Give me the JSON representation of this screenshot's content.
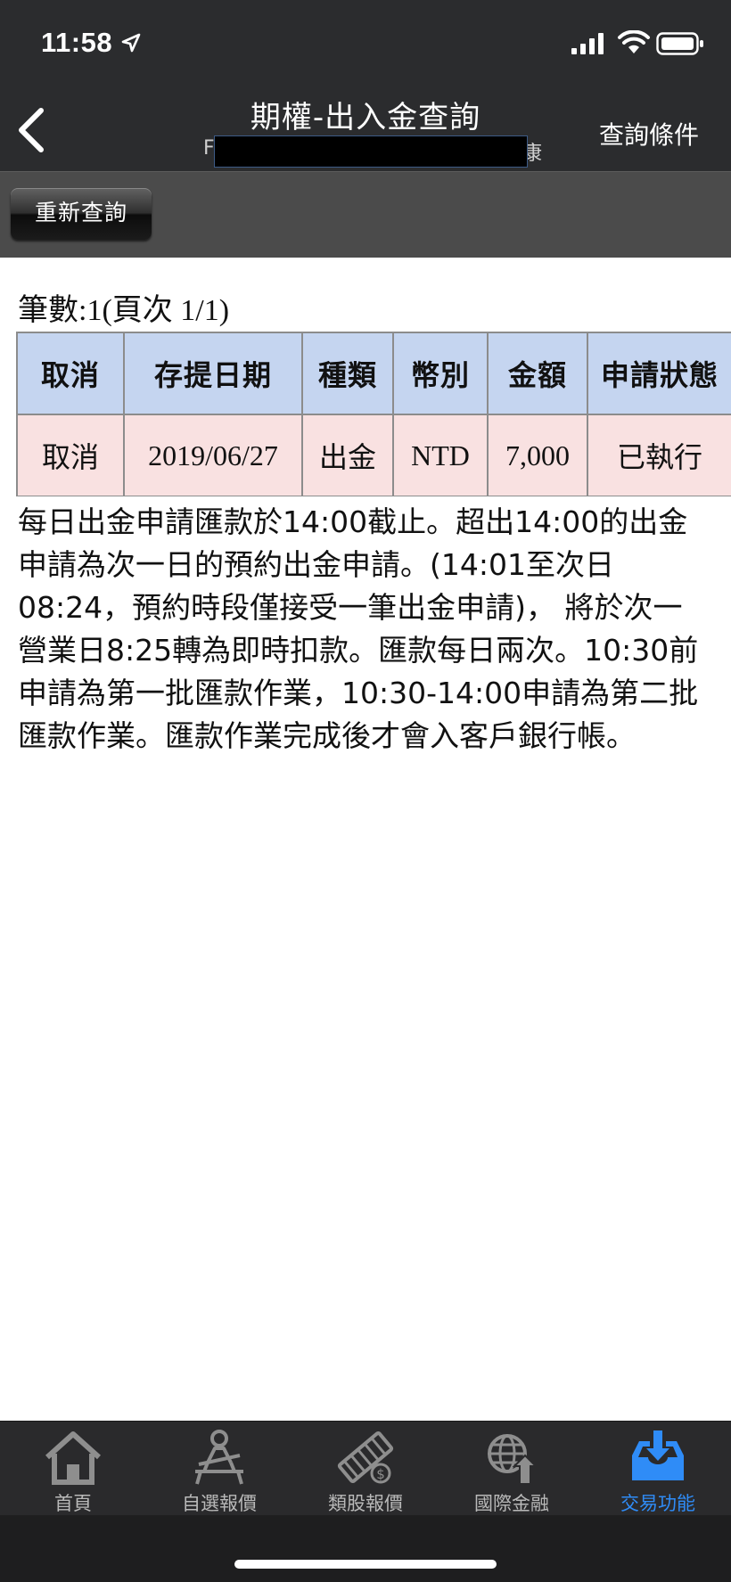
{
  "status_bar": {
    "time": "11:58"
  },
  "nav": {
    "title": "期權-出入金查詢",
    "account_prefix": "F",
    "account_suffix": "康",
    "query_conditions_label": "查詢條件"
  },
  "toolbar": {
    "requery_label": "重新查詢"
  },
  "summary": {
    "record_count_text": "筆數:1(頁次 1/1)"
  },
  "table": {
    "headers": [
      "取消",
      "存提日期",
      "種類",
      "幣別",
      "金額",
      "申請狀態"
    ],
    "rows": [
      {
        "cancel": "取消",
        "date": "2019/06/27",
        "type": "出金",
        "currency": "NTD",
        "amount": "7,000",
        "status": "已執行"
      }
    ]
  },
  "notice": {
    "lines": [
      "每日出金申請匯款於14:00截止。超出14:00的出金",
      "申請為次一日的預約出金申請。(14:01至次日",
      "08:24，預約時段僅接受一筆出金申請)， 將於次一",
      "營業日8:25轉為即時扣款。匯款每日兩次。10:30前",
      "申請為第一批匯款作業，10:30-14:00申請為第二批",
      "匯款作業。匯款作業完成後才會入客戶銀行帳。"
    ]
  },
  "tabs": [
    {
      "label": "首頁",
      "icon": "home-icon",
      "active": false
    },
    {
      "label": "自選報價",
      "icon": "person-desk-icon",
      "active": false
    },
    {
      "label": "類股報價",
      "icon": "film-dollar-icon",
      "active": false
    },
    {
      "label": "國際金融",
      "icon": "globe-arrow-icon",
      "active": false
    },
    {
      "label": "交易功能",
      "icon": "tray-download-icon",
      "active": true
    }
  ],
  "colors": {
    "header_bg": "#2b2c2e",
    "table_header_bg": "#c5d5f0",
    "table_row_bg": "#f9e1e1",
    "withdraw_red": "#e01010",
    "active_tab_blue": "#2f8cf7"
  }
}
